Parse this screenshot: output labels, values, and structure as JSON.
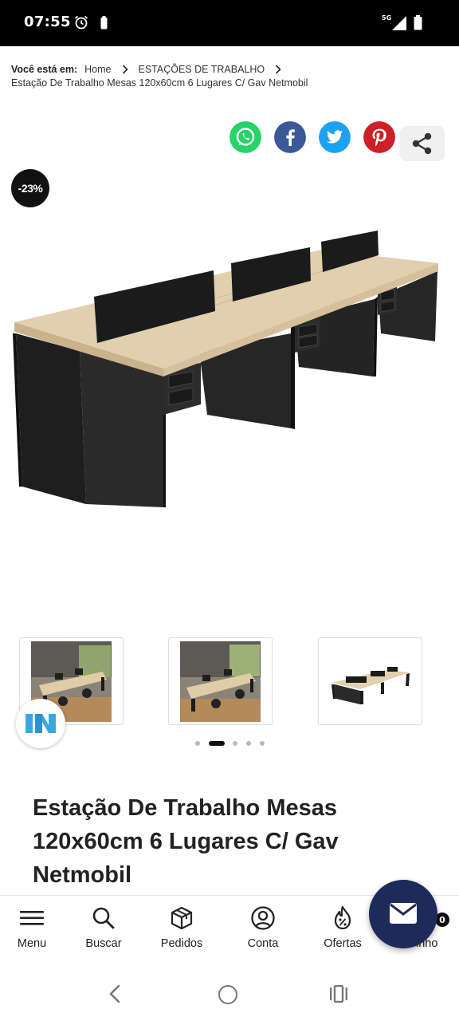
{
  "status_bar": {
    "time": "07:55",
    "network": "5G",
    "icons": [
      "alarm-icon",
      "battery-saver-icon",
      "signal-icon",
      "battery-icon"
    ]
  },
  "breadcrumb": {
    "prefix": "Você está em:",
    "items": [
      "Home",
      "ESTAÇÕES DE TRABALHO"
    ],
    "current": "Estação De Trabalho Mesas 120x60cm 6 Lugares C/ Gav Netmobil",
    "separator_icon": "chevron-right-icon"
  },
  "share": {
    "items": [
      {
        "name": "whatsapp",
        "color": "#25d366",
        "icon": "whatsapp-icon"
      },
      {
        "name": "facebook",
        "color": "#3b5998",
        "icon": "facebook-icon"
      },
      {
        "name": "twitter",
        "color": "#1da1f2",
        "icon": "twitter-icon"
      },
      {
        "name": "pinterest",
        "color": "#cb2027",
        "icon": "pinterest-icon"
      }
    ],
    "share_icon": "share-icon"
  },
  "product": {
    "discount": "-23%",
    "title": "Estação De Trabalho Mesas 120x60cm 6 Lugares C/ Gav Netmobil",
    "gallery": {
      "thumbnail_count": 3,
      "dots_count": 5,
      "active_dot": 2
    },
    "colors": {
      "wood": "#e2cfae",
      "body": "#1f1f1f"
    }
  },
  "bottom_nav": {
    "items": [
      {
        "label": "Menu",
        "icon": "menu-icon"
      },
      {
        "label": "Buscar",
        "icon": "search-icon"
      },
      {
        "label": "Pedidos",
        "icon": "box-icon"
      },
      {
        "label": "Conta",
        "icon": "user-icon"
      },
      {
        "label": "Ofertas",
        "icon": "discount-icon"
      },
      {
        "label": "inho",
        "icon": "cart-icon"
      }
    ],
    "cart_count": "0",
    "fab_icon": "mail-icon",
    "fab_color": "#1e2a5a"
  },
  "system_nav": {
    "icons": [
      "back-icon",
      "home-icon",
      "recents-icon"
    ]
  }
}
